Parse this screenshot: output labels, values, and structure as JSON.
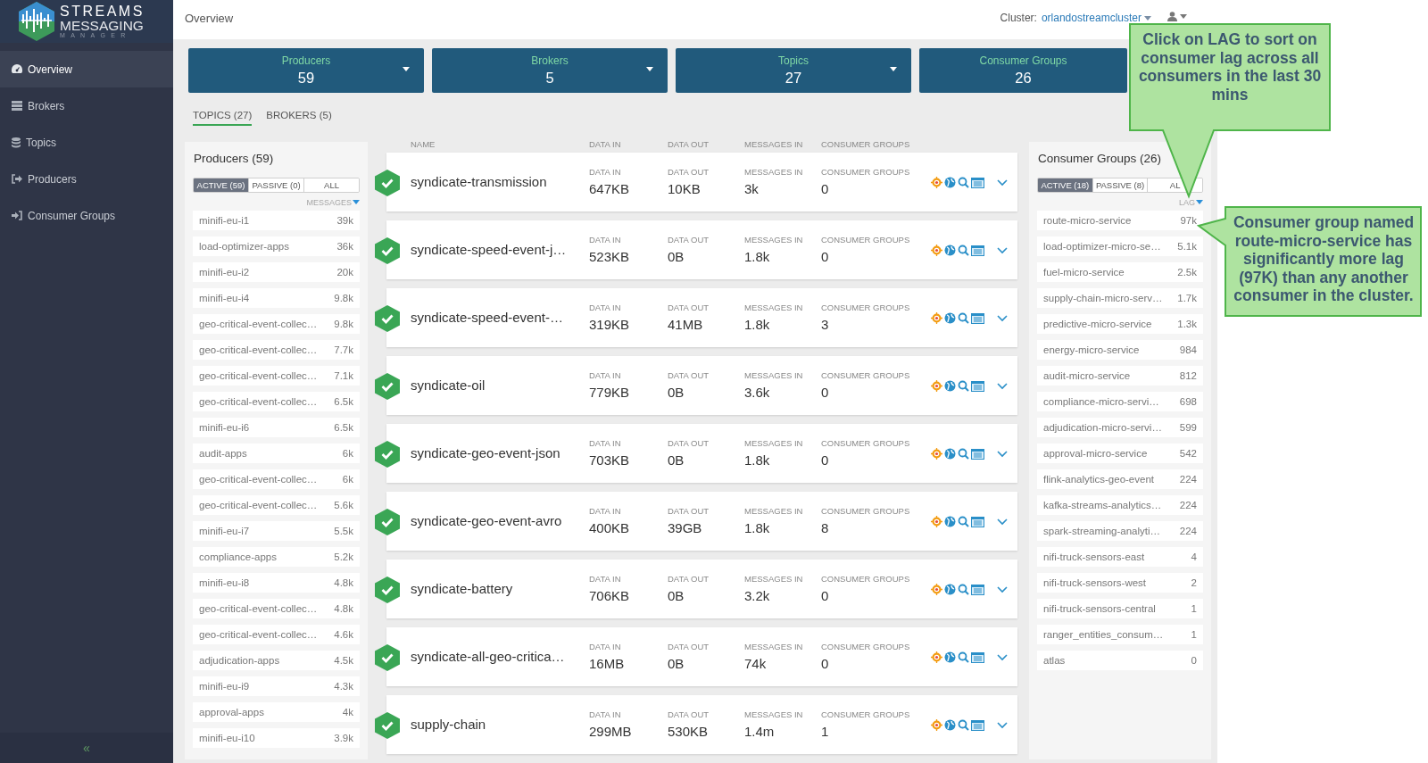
{
  "brand": [
    "STREAMS",
    "MESSAGING",
    "MANAGER"
  ],
  "sidebar": {
    "items": [
      {
        "label": "Overview",
        "selected": true
      },
      {
        "label": "Brokers",
        "selected": false
      },
      {
        "label": "Topics",
        "selected": false
      },
      {
        "label": "Producers",
        "selected": false
      },
      {
        "label": "Consumer Groups",
        "selected": false
      }
    ],
    "collapse": "«"
  },
  "header": {
    "title": "Overview",
    "cluster_label": "Cluster:",
    "cluster": "orlandostreamcluster"
  },
  "summary_cards": [
    {
      "label": "Producers",
      "count": "59",
      "menu": true
    },
    {
      "label": "Brokers",
      "count": "5",
      "menu": true
    },
    {
      "label": "Topics",
      "count": "27",
      "menu": true
    },
    {
      "label": "Consumer Groups",
      "count": "26",
      "menu": false
    }
  ],
  "tabs": [
    {
      "label": "TOPICS (27)",
      "selected": true
    },
    {
      "label": "BROKERS (5)",
      "selected": false
    }
  ],
  "producers": {
    "title": "Producers (59)",
    "filters": [
      {
        "label": "ACTIVE (59)",
        "selected": true
      },
      {
        "label": "PASSIVE (0)",
        "selected": false
      },
      {
        "label": "ALL",
        "selected": false
      }
    ],
    "sort_label": "MESSAGES",
    "items": [
      {
        "name": "minifi-eu-i1",
        "value": "39k"
      },
      {
        "name": "load-optimizer-apps",
        "value": "36k"
      },
      {
        "name": "minifi-eu-i2",
        "value": "20k"
      },
      {
        "name": "minifi-eu-i4",
        "value": "9.8k"
      },
      {
        "name": "geo-critical-event-collec…",
        "value": "9.8k"
      },
      {
        "name": "geo-critical-event-collec…",
        "value": "7.7k"
      },
      {
        "name": "geo-critical-event-collec…",
        "value": "7.1k"
      },
      {
        "name": "geo-critical-event-collec…",
        "value": "6.5k"
      },
      {
        "name": "minifi-eu-i6",
        "value": "6.5k"
      },
      {
        "name": "audit-apps",
        "value": "6k"
      },
      {
        "name": "geo-critical-event-collec…",
        "value": "6k"
      },
      {
        "name": "geo-critical-event-collec…",
        "value": "5.6k"
      },
      {
        "name": "minifi-eu-i7",
        "value": "5.5k"
      },
      {
        "name": "compliance-apps",
        "value": "5.2k"
      },
      {
        "name": "minifi-eu-i8",
        "value": "4.8k"
      },
      {
        "name": "geo-critical-event-collec…",
        "value": "4.8k"
      },
      {
        "name": "geo-critical-event-collec…",
        "value": "4.6k"
      },
      {
        "name": "adjudication-apps",
        "value": "4.5k"
      },
      {
        "name": "minifi-eu-i9",
        "value": "4.3k"
      },
      {
        "name": "approval-apps",
        "value": "4k"
      },
      {
        "name": "minifi-eu-i10",
        "value": "3.9k"
      }
    ]
  },
  "topics": {
    "columns": [
      "NAME",
      "DATA IN",
      "DATA OUT",
      "MESSAGES IN",
      "CONSUMER GROUPS"
    ],
    "rows": [
      {
        "name": "syndicate-transmission",
        "fields": [
          {
            "label": "DATA IN",
            "value": "647KB"
          },
          {
            "label": "DATA OUT",
            "value": "10KB"
          },
          {
            "label": "MESSAGES IN",
            "value": "3k"
          },
          {
            "label": "CONSUMER GROUPS",
            "value": "0"
          }
        ]
      },
      {
        "name": "syndicate-speed-event-j…",
        "fields": [
          {
            "label": "DATA IN",
            "value": "523KB"
          },
          {
            "label": "DATA OUT",
            "value": "0B"
          },
          {
            "label": "MESSAGES IN",
            "value": "1.8k"
          },
          {
            "label": "CONSUMER GROUPS",
            "value": "0"
          }
        ]
      },
      {
        "name": "syndicate-speed-event-…",
        "fields": [
          {
            "label": "DATA IN",
            "value": "319KB"
          },
          {
            "label": "DATA OUT",
            "value": "41MB"
          },
          {
            "label": "MESSAGES IN",
            "value": "1.8k"
          },
          {
            "label": "CONSUMER GROUPS",
            "value": "3"
          }
        ]
      },
      {
        "name": "syndicate-oil",
        "fields": [
          {
            "label": "DATA IN",
            "value": "779KB"
          },
          {
            "label": "DATA OUT",
            "value": "0B"
          },
          {
            "label": "MESSAGES IN",
            "value": "3.6k"
          },
          {
            "label": "CONSUMER GROUPS",
            "value": "0"
          }
        ]
      },
      {
        "name": "syndicate-geo-event-json",
        "fields": [
          {
            "label": "DATA IN",
            "value": "703KB"
          },
          {
            "label": "DATA OUT",
            "value": "0B"
          },
          {
            "label": "MESSAGES IN",
            "value": "1.8k"
          },
          {
            "label": "CONSUMER GROUPS",
            "value": "0"
          }
        ]
      },
      {
        "name": "syndicate-geo-event-avro",
        "fields": [
          {
            "label": "DATA IN",
            "value": "400KB"
          },
          {
            "label": "DATA OUT",
            "value": "39GB"
          },
          {
            "label": "MESSAGES IN",
            "value": "1.8k"
          },
          {
            "label": "CONSUMER GROUPS",
            "value": "8"
          }
        ]
      },
      {
        "name": "syndicate-battery",
        "fields": [
          {
            "label": "DATA IN",
            "value": "706KB"
          },
          {
            "label": "DATA OUT",
            "value": "0B"
          },
          {
            "label": "MESSAGES IN",
            "value": "3.2k"
          },
          {
            "label": "CONSUMER GROUPS",
            "value": "0"
          }
        ]
      },
      {
        "name": "syndicate-all-geo-critica…",
        "fields": [
          {
            "label": "DATA IN",
            "value": "16MB"
          },
          {
            "label": "DATA OUT",
            "value": "0B"
          },
          {
            "label": "MESSAGES IN",
            "value": "74k"
          },
          {
            "label": "CONSUMER GROUPS",
            "value": "0"
          }
        ]
      },
      {
        "name": "supply-chain",
        "fields": [
          {
            "label": "DATA IN",
            "value": "299MB"
          },
          {
            "label": "DATA OUT",
            "value": "530KB"
          },
          {
            "label": "MESSAGES IN",
            "value": "1.4m"
          },
          {
            "label": "CONSUMER GROUPS",
            "value": "1"
          }
        ]
      }
    ]
  },
  "consumer_groups": {
    "title": "Consumer Groups (26)",
    "filters": [
      {
        "label": "ACTIVE (18)",
        "selected": true
      },
      {
        "label": "PASSIVE (8)",
        "selected": false
      },
      {
        "label": "AL",
        "selected": false
      }
    ],
    "sort_label": "LAG",
    "items": [
      {
        "name": "route-micro-service",
        "value": "97k"
      },
      {
        "name": "load-optimizer-micro-se…",
        "value": "5.1k"
      },
      {
        "name": "fuel-micro-service",
        "value": "2.5k"
      },
      {
        "name": "supply-chain-micro-serv…",
        "value": "1.7k"
      },
      {
        "name": "predictive-micro-service",
        "value": "1.3k"
      },
      {
        "name": "energy-micro-service",
        "value": "984"
      },
      {
        "name": "audit-micro-service",
        "value": "812"
      },
      {
        "name": "compliance-micro-servi…",
        "value": "698"
      },
      {
        "name": "adjudication-micro-servi…",
        "value": "599"
      },
      {
        "name": "approval-micro-service",
        "value": "542"
      },
      {
        "name": "flink-analytics-geo-event",
        "value": "224"
      },
      {
        "name": "kafka-streams-analytics…",
        "value": "224"
      },
      {
        "name": "spark-streaming-analyti…",
        "value": "224"
      },
      {
        "name": "nifi-truck-sensors-east",
        "value": "4"
      },
      {
        "name": "nifi-truck-sensors-west",
        "value": "2"
      },
      {
        "name": "nifi-truck-sensors-central",
        "value": "1"
      },
      {
        "name": "ranger_entities_consum…",
        "value": "1"
      },
      {
        "name": "atlas",
        "value": "0"
      }
    ]
  },
  "callouts": [
    {
      "text": "Click on LAG to sort on consumer lag across all consumers in the last 30 mins",
      "kind": "pointer-down"
    },
    {
      "text": "Consumer group named route-micro-service has significantly more lag (97K) than any another consumer in the cluster.",
      "kind": "pointer-left"
    }
  ]
}
